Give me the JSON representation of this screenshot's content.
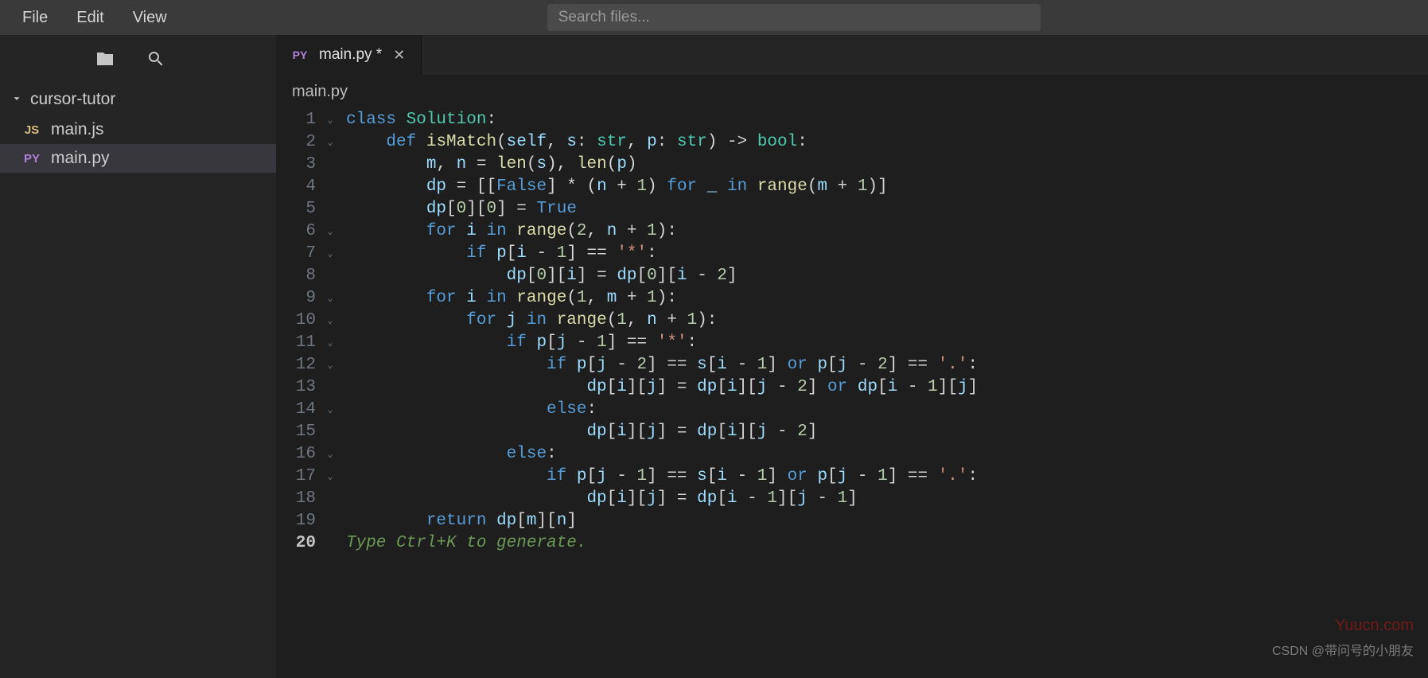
{
  "menubar": {
    "file": "File",
    "edit": "Edit",
    "view": "View"
  },
  "search": {
    "placeholder": "Search files..."
  },
  "sidebar": {
    "project": "cursor-tutor",
    "files": [
      {
        "badge": "JS",
        "name": "main.js"
      },
      {
        "badge": "PY",
        "name": "main.py"
      }
    ]
  },
  "tab": {
    "badge": "PY",
    "title": "main.py *",
    "close": "✕"
  },
  "breadcrumb": "main.py",
  "code": {
    "lines": [
      {
        "n": "1",
        "fold": "⌄",
        "tokens": [
          [
            "kw",
            "class "
          ],
          [
            "cls",
            "Solution"
          ],
          [
            "op",
            ":"
          ]
        ]
      },
      {
        "n": "2",
        "fold": "⌄",
        "tokens": [
          [
            "op",
            "    "
          ],
          [
            "kw",
            "def "
          ],
          [
            "fn",
            "isMatch"
          ],
          [
            "op",
            "("
          ],
          [
            "var",
            "self"
          ],
          [
            "op",
            ", "
          ],
          [
            "var",
            "s"
          ],
          [
            "op",
            ": "
          ],
          [
            "cls",
            "str"
          ],
          [
            "op",
            ", "
          ],
          [
            "var",
            "p"
          ],
          [
            "op",
            ": "
          ],
          [
            "cls",
            "str"
          ],
          [
            "op",
            ") -> "
          ],
          [
            "cls",
            "bool"
          ],
          [
            "op",
            ":"
          ]
        ]
      },
      {
        "n": "3",
        "fold": "",
        "tokens": [
          [
            "op",
            "        "
          ],
          [
            "var",
            "m"
          ],
          [
            "op",
            ", "
          ],
          [
            "var",
            "n"
          ],
          [
            "op",
            " = "
          ],
          [
            "fn",
            "len"
          ],
          [
            "op",
            "("
          ],
          [
            "var",
            "s"
          ],
          [
            "op",
            ")"
          ],
          [
            "op",
            ", "
          ],
          [
            "fn",
            "len"
          ],
          [
            "op",
            "("
          ],
          [
            "var",
            "p"
          ],
          [
            "op",
            ")"
          ]
        ]
      },
      {
        "n": "4",
        "fold": "",
        "tokens": [
          [
            "op",
            "        "
          ],
          [
            "var",
            "dp"
          ],
          [
            "op",
            " = [["
          ],
          [
            "const",
            "False"
          ],
          [
            "op",
            "] * ("
          ],
          [
            "var",
            "n"
          ],
          [
            "op",
            " + "
          ],
          [
            "num",
            "1"
          ],
          [
            "op",
            ") "
          ],
          [
            "kw",
            "for"
          ],
          [
            "op",
            " "
          ],
          [
            "var",
            "_"
          ],
          [
            "op",
            " "
          ],
          [
            "kw",
            "in"
          ],
          [
            "op",
            " "
          ],
          [
            "fn",
            "range"
          ],
          [
            "op",
            "("
          ],
          [
            "var",
            "m"
          ],
          [
            "op",
            " + "
          ],
          [
            "num",
            "1"
          ],
          [
            "op",
            ")]"
          ]
        ]
      },
      {
        "n": "5",
        "fold": "",
        "tokens": [
          [
            "op",
            "        "
          ],
          [
            "var",
            "dp"
          ],
          [
            "op",
            "["
          ],
          [
            "num",
            "0"
          ],
          [
            "op",
            "]["
          ],
          [
            "num",
            "0"
          ],
          [
            "op",
            "] = "
          ],
          [
            "const",
            "True"
          ]
        ]
      },
      {
        "n": "6",
        "fold": "⌄",
        "tokens": [
          [
            "op",
            "        "
          ],
          [
            "kw",
            "for"
          ],
          [
            "op",
            " "
          ],
          [
            "var",
            "i"
          ],
          [
            "op",
            " "
          ],
          [
            "kw",
            "in"
          ],
          [
            "op",
            " "
          ],
          [
            "fn",
            "range"
          ],
          [
            "op",
            "("
          ],
          [
            "num",
            "2"
          ],
          [
            "op",
            ", "
          ],
          [
            "var",
            "n"
          ],
          [
            "op",
            " + "
          ],
          [
            "num",
            "1"
          ],
          [
            "op",
            "):"
          ]
        ]
      },
      {
        "n": "7",
        "fold": "⌄",
        "tokens": [
          [
            "op",
            "            "
          ],
          [
            "kw",
            "if"
          ],
          [
            "op",
            " "
          ],
          [
            "var",
            "p"
          ],
          [
            "op",
            "["
          ],
          [
            "var",
            "i"
          ],
          [
            "op",
            " - "
          ],
          [
            "num",
            "1"
          ],
          [
            "op",
            "] == "
          ],
          [
            "str",
            "'*'"
          ],
          [
            "op",
            ":"
          ]
        ]
      },
      {
        "n": "8",
        "fold": "",
        "tokens": [
          [
            "op",
            "                "
          ],
          [
            "var",
            "dp"
          ],
          [
            "op",
            "["
          ],
          [
            "num",
            "0"
          ],
          [
            "op",
            "]["
          ],
          [
            "var",
            "i"
          ],
          [
            "op",
            "] = "
          ],
          [
            "var",
            "dp"
          ],
          [
            "op",
            "["
          ],
          [
            "num",
            "0"
          ],
          [
            "op",
            "]["
          ],
          [
            "var",
            "i"
          ],
          [
            "op",
            " - "
          ],
          [
            "num",
            "2"
          ],
          [
            "op",
            "]"
          ]
        ]
      },
      {
        "n": "9",
        "fold": "⌄",
        "tokens": [
          [
            "op",
            "        "
          ],
          [
            "kw",
            "for"
          ],
          [
            "op",
            " "
          ],
          [
            "var",
            "i"
          ],
          [
            "op",
            " "
          ],
          [
            "kw",
            "in"
          ],
          [
            "op",
            " "
          ],
          [
            "fn",
            "range"
          ],
          [
            "op",
            "("
          ],
          [
            "num",
            "1"
          ],
          [
            "op",
            ", "
          ],
          [
            "var",
            "m"
          ],
          [
            "op",
            " + "
          ],
          [
            "num",
            "1"
          ],
          [
            "op",
            "):"
          ]
        ]
      },
      {
        "n": "10",
        "fold": "⌄",
        "tokens": [
          [
            "op",
            "            "
          ],
          [
            "kw",
            "for"
          ],
          [
            "op",
            " "
          ],
          [
            "var",
            "j"
          ],
          [
            "op",
            " "
          ],
          [
            "kw",
            "in"
          ],
          [
            "op",
            " "
          ],
          [
            "fn",
            "range"
          ],
          [
            "op",
            "("
          ],
          [
            "num",
            "1"
          ],
          [
            "op",
            ", "
          ],
          [
            "var",
            "n"
          ],
          [
            "op",
            " + "
          ],
          [
            "num",
            "1"
          ],
          [
            "op",
            "):"
          ]
        ]
      },
      {
        "n": "11",
        "fold": "⌄",
        "tokens": [
          [
            "op",
            "                "
          ],
          [
            "kw",
            "if"
          ],
          [
            "op",
            " "
          ],
          [
            "var",
            "p"
          ],
          [
            "op",
            "["
          ],
          [
            "var",
            "j"
          ],
          [
            "op",
            " - "
          ],
          [
            "num",
            "1"
          ],
          [
            "op",
            "] == "
          ],
          [
            "str",
            "'*'"
          ],
          [
            "op",
            ":"
          ]
        ]
      },
      {
        "n": "12",
        "fold": "⌄",
        "tokens": [
          [
            "op",
            "                    "
          ],
          [
            "kw",
            "if"
          ],
          [
            "op",
            " "
          ],
          [
            "var",
            "p"
          ],
          [
            "op",
            "["
          ],
          [
            "var",
            "j"
          ],
          [
            "op",
            " - "
          ],
          [
            "num",
            "2"
          ],
          [
            "op",
            "] == "
          ],
          [
            "var",
            "s"
          ],
          [
            "op",
            "["
          ],
          [
            "var",
            "i"
          ],
          [
            "op",
            " - "
          ],
          [
            "num",
            "1"
          ],
          [
            "op",
            "] "
          ],
          [
            "kw",
            "or"
          ],
          [
            "op",
            " "
          ],
          [
            "var",
            "p"
          ],
          [
            "op",
            "["
          ],
          [
            "var",
            "j"
          ],
          [
            "op",
            " - "
          ],
          [
            "num",
            "2"
          ],
          [
            "op",
            "] == "
          ],
          [
            "str",
            "'.'"
          ],
          [
            "op",
            ":"
          ]
        ]
      },
      {
        "n": "13",
        "fold": "",
        "tokens": [
          [
            "op",
            "                        "
          ],
          [
            "var",
            "dp"
          ],
          [
            "op",
            "["
          ],
          [
            "var",
            "i"
          ],
          [
            "op",
            "]["
          ],
          [
            "var",
            "j"
          ],
          [
            "op",
            "] = "
          ],
          [
            "var",
            "dp"
          ],
          [
            "op",
            "["
          ],
          [
            "var",
            "i"
          ],
          [
            "op",
            "]["
          ],
          [
            "var",
            "j"
          ],
          [
            "op",
            " - "
          ],
          [
            "num",
            "2"
          ],
          [
            "op",
            "] "
          ],
          [
            "kw",
            "or"
          ],
          [
            "op",
            " "
          ],
          [
            "var",
            "dp"
          ],
          [
            "op",
            "["
          ],
          [
            "var",
            "i"
          ],
          [
            "op",
            " - "
          ],
          [
            "num",
            "1"
          ],
          [
            "op",
            "]["
          ],
          [
            "var",
            "j"
          ],
          [
            "op",
            "]"
          ]
        ]
      },
      {
        "n": "14",
        "fold": "⌄",
        "tokens": [
          [
            "op",
            "                    "
          ],
          [
            "kw",
            "else"
          ],
          [
            "op",
            ":"
          ]
        ]
      },
      {
        "n": "15",
        "fold": "",
        "tokens": [
          [
            "op",
            "                        "
          ],
          [
            "var",
            "dp"
          ],
          [
            "op",
            "["
          ],
          [
            "var",
            "i"
          ],
          [
            "op",
            "]["
          ],
          [
            "var",
            "j"
          ],
          [
            "op",
            "] = "
          ],
          [
            "var",
            "dp"
          ],
          [
            "op",
            "["
          ],
          [
            "var",
            "i"
          ],
          [
            "op",
            "]["
          ],
          [
            "var",
            "j"
          ],
          [
            "op",
            " - "
          ],
          [
            "num",
            "2"
          ],
          [
            "op",
            "]"
          ]
        ]
      },
      {
        "n": "16",
        "fold": "⌄",
        "tokens": [
          [
            "op",
            "                "
          ],
          [
            "kw",
            "else"
          ],
          [
            "op",
            ":"
          ]
        ]
      },
      {
        "n": "17",
        "fold": "⌄",
        "tokens": [
          [
            "op",
            "                    "
          ],
          [
            "kw",
            "if"
          ],
          [
            "op",
            " "
          ],
          [
            "var",
            "p"
          ],
          [
            "op",
            "["
          ],
          [
            "var",
            "j"
          ],
          [
            "op",
            " - "
          ],
          [
            "num",
            "1"
          ],
          [
            "op",
            "] == "
          ],
          [
            "var",
            "s"
          ],
          [
            "op",
            "["
          ],
          [
            "var",
            "i"
          ],
          [
            "op",
            " - "
          ],
          [
            "num",
            "1"
          ],
          [
            "op",
            "] "
          ],
          [
            "kw",
            "or"
          ],
          [
            "op",
            " "
          ],
          [
            "var",
            "p"
          ],
          [
            "op",
            "["
          ],
          [
            "var",
            "j"
          ],
          [
            "op",
            " - "
          ],
          [
            "num",
            "1"
          ],
          [
            "op",
            "] == "
          ],
          [
            "str",
            "'.'"
          ],
          [
            "op",
            ":"
          ]
        ]
      },
      {
        "n": "18",
        "fold": "",
        "tokens": [
          [
            "op",
            "                        "
          ],
          [
            "var",
            "dp"
          ],
          [
            "op",
            "["
          ],
          [
            "var",
            "i"
          ],
          [
            "op",
            "]["
          ],
          [
            "var",
            "j"
          ],
          [
            "op",
            "] = "
          ],
          [
            "var",
            "dp"
          ],
          [
            "op",
            "["
          ],
          [
            "var",
            "i"
          ],
          [
            "op",
            " - "
          ],
          [
            "num",
            "1"
          ],
          [
            "op",
            "]["
          ],
          [
            "var",
            "j"
          ],
          [
            "op",
            " - "
          ],
          [
            "num",
            "1"
          ],
          [
            "op",
            "]"
          ]
        ]
      },
      {
        "n": "19",
        "fold": "",
        "tokens": [
          [
            "op",
            "        "
          ],
          [
            "kw",
            "return"
          ],
          [
            "op",
            " "
          ],
          [
            "var",
            "dp"
          ],
          [
            "op",
            "["
          ],
          [
            "var",
            "m"
          ],
          [
            "op",
            "]["
          ],
          [
            "var",
            "n"
          ],
          [
            "op",
            "]"
          ]
        ]
      },
      {
        "n": "20",
        "fold": "",
        "active": true,
        "tokens": [
          [
            "hint",
            "Type Ctrl+K to generate."
          ]
        ]
      }
    ]
  },
  "watermark1": "Yuucn.com",
  "watermark2": "CSDN @带问号的小朋友"
}
